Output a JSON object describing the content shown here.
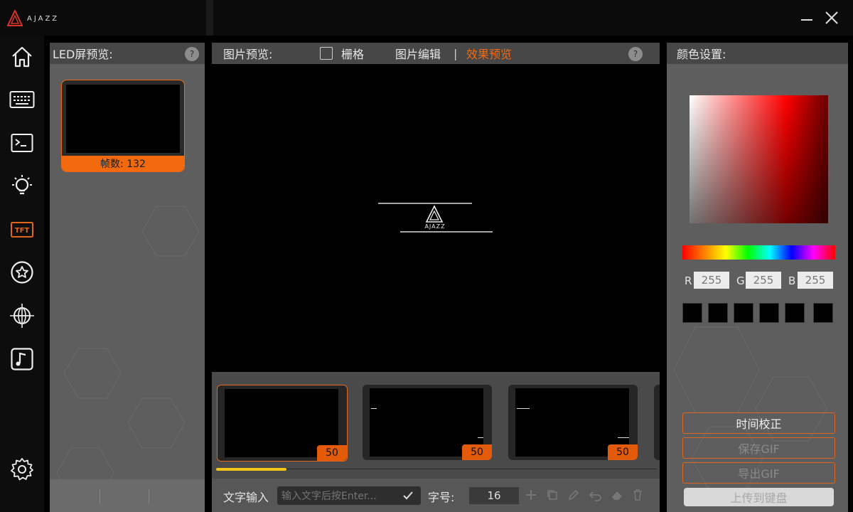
{
  "app": {
    "logo_text": "AJAZZ",
    "minimize_icon": "minimize-icon",
    "close_icon": "close-icon"
  },
  "sidebar": {
    "items": [
      {
        "icon": "home-icon"
      },
      {
        "icon": "keyboard-icon"
      },
      {
        "icon": "terminal-icon"
      },
      {
        "icon": "lightbulb-icon"
      },
      {
        "icon": "tft-icon",
        "label": "TFT"
      },
      {
        "icon": "star-circle-icon"
      },
      {
        "icon": "globe-icon"
      },
      {
        "icon": "music-icon"
      }
    ],
    "settings_icon": "gear-icon"
  },
  "led_panel": {
    "title": "LED屏预览:",
    "help": "?",
    "frames_label": "帧数: 132"
  },
  "image_panel": {
    "title": "图片预览:",
    "grid_label": "栅格",
    "tab_edit": "图片编辑",
    "tab_divider": "|",
    "tab_effect": "效果预览",
    "help": "?",
    "preview_logo_text": "AJAZZ",
    "thumbnails": [
      {
        "badge": "50"
      },
      {
        "badge": "50"
      },
      {
        "badge": "50"
      }
    ],
    "progress": 0.16,
    "text_input_label": "文字输入",
    "text_input_placeholder": "输入文字后按Enter...",
    "font_size_label": "字号:",
    "font_size_value": "16"
  },
  "color_panel": {
    "title": "颜色设置:",
    "r_label": "R",
    "r_value": "255",
    "g_label": "G",
    "g_value": "255",
    "b_label": "B",
    "b_value": "255",
    "swatch_color": "#000000",
    "btn_time": "时间校正",
    "btn_save_gif": "保存GIF",
    "btn_export_gif": "导出GIF",
    "btn_upload": "上传到键盘"
  },
  "colors": {
    "accent": "#f26a14",
    "progress": "#f0c419"
  }
}
